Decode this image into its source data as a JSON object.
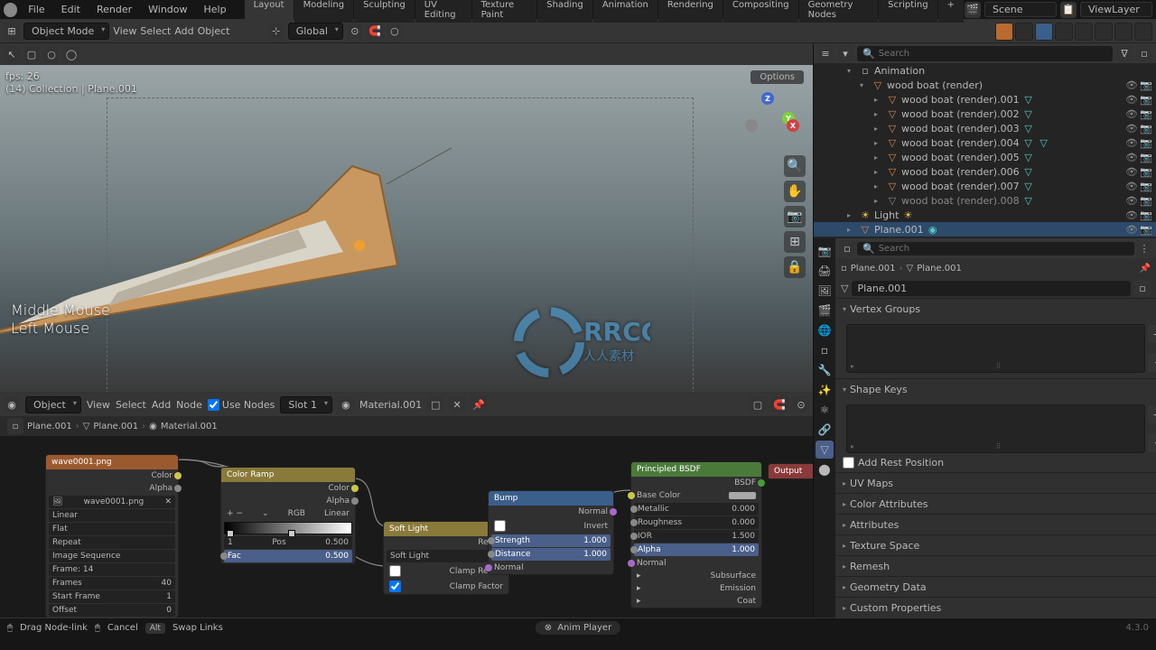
{
  "top": {
    "menus": [
      "File",
      "Edit",
      "Render",
      "Window",
      "Help"
    ],
    "tabs": [
      "Layout",
      "Modeling",
      "Sculpting",
      "UV Editing",
      "Texture Paint",
      "Shading",
      "Animation",
      "Rendering",
      "Compositing",
      "Geometry Nodes",
      "Scripting"
    ],
    "active_tab": 0,
    "scene_label": "Scene",
    "viewlayer_label": "ViewLayer"
  },
  "hdr2": {
    "mode": "Object Mode",
    "menus": [
      "View",
      "Select",
      "Add",
      "Object"
    ],
    "orientation": "Global"
  },
  "viewport": {
    "fps": "fps: 26",
    "collection": "(14) Collection | Plane.001",
    "hint1": "Middle Mouse",
    "hint2": "Left Mouse",
    "options": "Options"
  },
  "outliner": {
    "search_ph": "Search",
    "animation": "Animation",
    "boat": "wood boat (render)",
    "children": [
      "wood boat (render).001",
      "wood boat (render).002",
      "wood boat (render).003",
      "wood boat (render).004",
      "wood boat (render).005",
      "wood boat (render).006",
      "wood boat (render).007",
      "wood boat (render).008"
    ],
    "light": "Light",
    "plane": "Plane.001"
  },
  "props": {
    "search_ph": "Search",
    "bc_obj": "Plane.001",
    "bc_mesh": "Plane.001",
    "name": "Plane.001",
    "panels": {
      "vertex_groups": "Vertex Groups",
      "shape_keys": "Shape Keys",
      "add_rest": "Add Rest Position",
      "uv_maps": "UV Maps",
      "color_attrs": "Color Attributes",
      "attributes": "Attributes",
      "texspace": "Texture Space",
      "remesh": "Remesh",
      "geodata": "Geometry Data",
      "custom": "Custom Properties"
    }
  },
  "ne": {
    "menus": [
      "View",
      "Select",
      "Add",
      "Node"
    ],
    "object": "Object",
    "use_nodes": "Use Nodes",
    "slot": "Slot 1",
    "material": "Material.001",
    "bc": [
      "Plane.001",
      "Plane.001",
      "Material.001"
    ]
  },
  "nodes": {
    "imgtex": {
      "title": "wave0001.png",
      "file": "wave0001.png",
      "out_color": "Color",
      "out_alpha": "Alpha",
      "interp": "Linear",
      "proj": "Flat",
      "ext": "Repeat",
      "src": "Image Sequence",
      "frame_line": "Frame: 14",
      "frames_l": "Frames",
      "frames_v": "40",
      "start_l": "Start Frame",
      "start_v": "1",
      "offset_l": "Offset",
      "offset_v": "0"
    },
    "ramp": {
      "title": "Color Ramp",
      "out_color": "Color",
      "out_alpha": "Alpha",
      "mode": "RGB",
      "interp": "Linear",
      "idx_l": "1",
      "pos_l": "Pos",
      "pos_v": "0.500",
      "fac_l": "Fac",
      "fac_v": "0.500"
    },
    "mixcol": {
      "title": "Soft Light",
      "out": "Result",
      "method": "Soft Light",
      "clamp_result": "Clamp Result",
      "clamp_factor": "Clamp Factor"
    },
    "bump": {
      "title": "Bump",
      "out": "Normal",
      "invert": "Invert",
      "strength_l": "Strength",
      "strength_v": "1.000",
      "distance_l": "Distance",
      "distance_v": "1.000",
      "normal": "Normal"
    },
    "bsdf": {
      "title": "Principled BSDF",
      "out": "BSDF",
      "base": "Base Color",
      "metal_l": "Metallic",
      "metal_v": "0.000",
      "rough_l": "Roughness",
      "rough_v": "0.000",
      "ior_l": "IOR",
      "ior_v": "1.500",
      "alpha_l": "Alpha",
      "alpha_v": "1.000",
      "normal": "Normal",
      "subsurface": "Subsurface",
      "emission": "Emission",
      "coat": "Coat"
    },
    "output": {
      "title": "Output"
    }
  },
  "status": {
    "drag": "Drag Node-link",
    "cancel": "Cancel",
    "alt": "Alt",
    "swap": "Swap Links",
    "anim": "Anim Player",
    "version": "4.3.0"
  },
  "watermark": {
    "main": "RRCG",
    "sub": "人人素材"
  }
}
